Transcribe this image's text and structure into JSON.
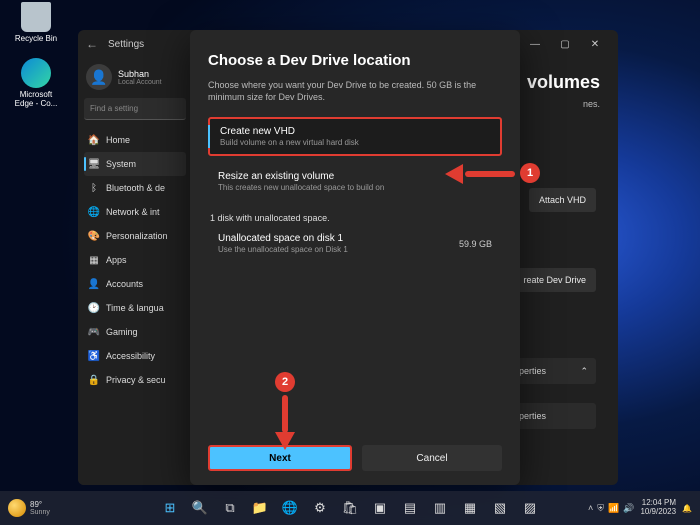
{
  "desktop": {
    "recycle": "Recycle Bin",
    "edge": "Microsoft Edge - Co..."
  },
  "settings": {
    "title": "Settings",
    "profile_name": "Subhan",
    "profile_acct": "Local Account",
    "search_placeholder": "Find a setting",
    "nav": [
      {
        "icon": "🏠",
        "label": "Home"
      },
      {
        "icon": "🖥",
        "label": "System"
      },
      {
        "icon": "ᛒ",
        "label": "Bluetooth & de"
      },
      {
        "icon": "🌐",
        "label": "Network & int"
      },
      {
        "icon": "🎨",
        "label": "Personalization"
      },
      {
        "icon": "▦",
        "label": "Apps"
      },
      {
        "icon": "👤",
        "label": "Accounts"
      },
      {
        "icon": "🕑",
        "label": "Time & langua"
      },
      {
        "icon": "🎮",
        "label": "Gaming"
      },
      {
        "icon": "♿",
        "label": "Accessibility"
      },
      {
        "icon": "🔒",
        "label": "Privacy & secu"
      }
    ],
    "main": {
      "heading_tail": "volumes",
      "heading_sub": "nes.",
      "attach": "Attach VHD",
      "create": "reate Dev Drive",
      "prop": "operties",
      "chev": "⌃"
    }
  },
  "dialog": {
    "title": "Choose a Dev Drive location",
    "sub": "Choose where you want your Dev Drive to be created. 50 GB is the minimum size for Dev Drives.",
    "opt1_title": "Create new VHD",
    "opt1_sub": "Build volume on a new virtual hard disk",
    "opt2_title": "Resize an existing volume",
    "opt2_sub": "This creates new unallocated space to build on",
    "sect": "1 disk with unallocated space.",
    "opt3_title": "Unallocated space on disk 1",
    "opt3_sub": "Use the unallocated space on Disk 1",
    "opt3_size": "59.9 GB",
    "next": "Next",
    "cancel": "Cancel"
  },
  "anno": {
    "n1": "1",
    "n2": "2"
  },
  "taskbar": {
    "temp": "89°",
    "cond": "Sunny",
    "datetime": {
      "time": "12:04 PM",
      "date": "10/9/2023"
    }
  },
  "colors": {
    "accent": "#4cc2ff",
    "anno": "#e03c31"
  }
}
